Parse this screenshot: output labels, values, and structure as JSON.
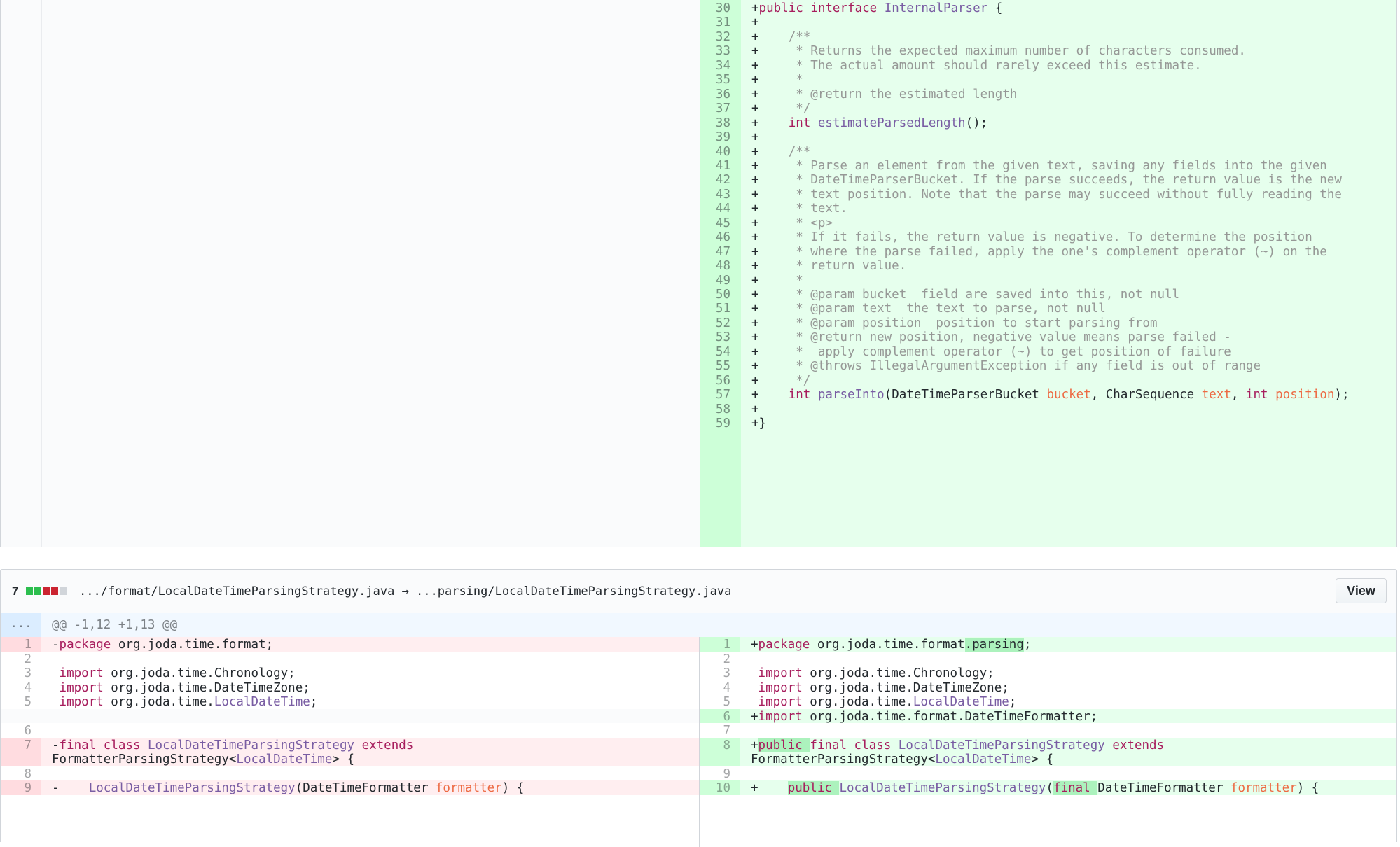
{
  "top_file": {
    "rows": [
      {
        "num": "30",
        "code": "+public interface InternalParser {"
      },
      {
        "num": "31",
        "code": "+"
      },
      {
        "num": "32",
        "code": "+    /**"
      },
      {
        "num": "33",
        "code": "+     * Returns the expected maximum number of characters consumed."
      },
      {
        "num": "34",
        "code": "+     * The actual amount should rarely exceed this estimate."
      },
      {
        "num": "35",
        "code": "+     *"
      },
      {
        "num": "36",
        "code": "+     * @return the estimated length"
      },
      {
        "num": "37",
        "code": "+     */"
      },
      {
        "num": "38",
        "code": "+    int estimateParsedLength();"
      },
      {
        "num": "39",
        "code": "+"
      },
      {
        "num": "40",
        "code": "+    /**"
      },
      {
        "num": "41",
        "code": "+     * Parse an element from the given text, saving any fields into the given"
      },
      {
        "num": "42",
        "code": "+     * DateTimeParserBucket. If the parse succeeds, the return value is the new"
      },
      {
        "num": "43",
        "code": "+     * text position. Note that the parse may succeed without fully reading the"
      },
      {
        "num": "44",
        "code": "+     * text."
      },
      {
        "num": "45",
        "code": "+     * <p>"
      },
      {
        "num": "46",
        "code": "+     * If it fails, the return value is negative. To determine the position"
      },
      {
        "num": "47",
        "code": "+     * where the parse failed, apply the one's complement operator (~) on the"
      },
      {
        "num": "48",
        "code": "+     * return value."
      },
      {
        "num": "49",
        "code": "+     *"
      },
      {
        "num": "50",
        "code": "+     * @param bucket  field are saved into this, not null"
      },
      {
        "num": "51",
        "code": "+     * @param text  the text to parse, not null"
      },
      {
        "num": "52",
        "code": "+     * @param position  position to start parsing from"
      },
      {
        "num": "53",
        "code": "+     * @return new position, negative value means parse failed -"
      },
      {
        "num": "54",
        "code": "+     *  apply complement operator (~) to get position of failure"
      },
      {
        "num": "55",
        "code": "+     * @throws IllegalArgumentException if any field is out of range"
      },
      {
        "num": "56",
        "code": "+     */"
      },
      {
        "num": "57",
        "code": "+    int parseInto(DateTimeParserBucket bucket, CharSequence text, int position);"
      },
      {
        "num": "58",
        "code": "+"
      },
      {
        "num": "59",
        "code": "+}"
      }
    ]
  },
  "file_header": {
    "changes": "7",
    "path": ".../format/LocalDateTimeParsingStrategy.java → ...parsing/LocalDateTimeParsingStrategy.java",
    "view_label": "View"
  },
  "hunk": {
    "expand": "...",
    "header": "@@ -1,12 +1,13 @@"
  },
  "left_rows": [
    {
      "num": "1",
      "code": "-package org.joda.time.format;"
    },
    {
      "num": "2",
      "code": ""
    },
    {
      "num": "3",
      "code": " import org.joda.time.Chronology;"
    },
    {
      "num": "4",
      "code": " import org.joda.time.DateTimeZone;"
    },
    {
      "num": "5",
      "code": " import org.joda.time.LocalDateTime;"
    },
    {
      "num": "",
      "code": ""
    },
    {
      "num": "6",
      "code": ""
    },
    {
      "num": "7",
      "code": "-final class LocalDateTimeParsingStrategy extends"
    },
    {
      "num": "",
      "code": "FormatterParsingStrategy<LocalDateTime> {"
    },
    {
      "num": "8",
      "code": ""
    },
    {
      "num": "9",
      "code": "-    LocalDateTimeParsingStrategy(DateTimeFormatter formatter) {"
    }
  ],
  "right_rows": [
    {
      "num": "1",
      "code": "+package org.joda.time.format.parsing;"
    },
    {
      "num": "2",
      "code": ""
    },
    {
      "num": "3",
      "code": " import org.joda.time.Chronology;"
    },
    {
      "num": "4",
      "code": " import org.joda.time.DateTimeZone;"
    },
    {
      "num": "5",
      "code": " import org.joda.time.LocalDateTime;"
    },
    {
      "num": "6",
      "code": "+import org.joda.time.format.DateTimeFormatter;"
    },
    {
      "num": "7",
      "code": ""
    },
    {
      "num": "8",
      "code": "+public final class LocalDateTimeParsingStrategy extends"
    },
    {
      "num": "",
      "code": "FormatterParsingStrategy<LocalDateTime> {"
    },
    {
      "num": "9",
      "code": ""
    },
    {
      "num": "10",
      "code": "+    public LocalDateTimeParsingStrategy(final DateTimeFormatter formatter) {"
    }
  ],
  "colors": {
    "addition_bg": "#e6ffed",
    "addition_gutter": "#cdffd8",
    "deletion_bg": "#ffeef0",
    "deletion_gutter": "#ffdce0",
    "empty_bg": "#fafbfc",
    "keyword": "#a71d5d",
    "entity": "#795da3",
    "variable": "#ed6a43",
    "comment": "#969896",
    "stat_added": "#2cbe4e",
    "stat_removed": "#cb2431",
    "stat_neutral": "#d1d5da"
  }
}
